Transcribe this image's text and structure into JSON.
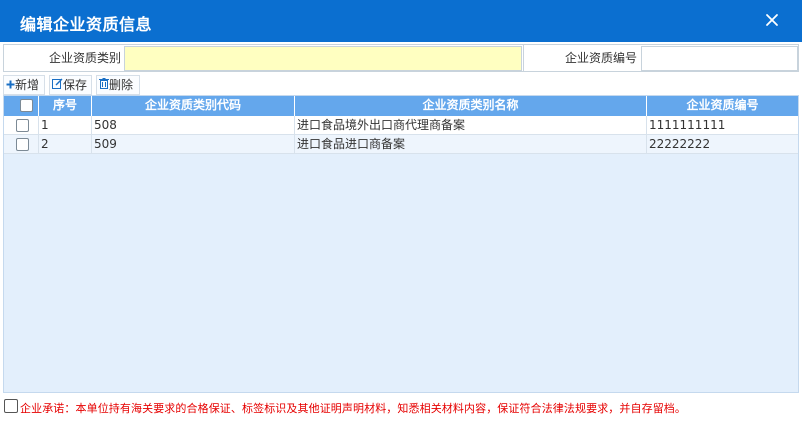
{
  "dialog": {
    "title": "编辑企业资质信息"
  },
  "form": {
    "category_label": "企业资质类别",
    "category_value": "",
    "number_label": "企业资质编号",
    "number_value": ""
  },
  "toolbar": {
    "add_label": "新增",
    "save_label": "保存",
    "delete_label": "删除"
  },
  "grid": {
    "columns": [
      "序号",
      "企业资质类别代码",
      "企业资质类别名称",
      "企业资质编号"
    ],
    "rows": [
      {
        "index": "1",
        "code": "508",
        "name": "进口食品境外出口商代理商备案",
        "number": "1111111111"
      },
      {
        "index": "2",
        "code": "509",
        "name": "进口食品进口商备案",
        "number": "22222222"
      }
    ]
  },
  "promise": {
    "text": "企业承诺：本单位持有海关要求的合格保证、标签标识及其他证明声明材料，知悉相关材料内容，保证符合法律法规要求，并自存留档。"
  },
  "colors": {
    "titlebar": "#0b6fd0",
    "grid_header": "#64a7ec",
    "grid_body": "#e3effc",
    "required_input": "#ffffc1",
    "promise_text": "#e60000"
  }
}
